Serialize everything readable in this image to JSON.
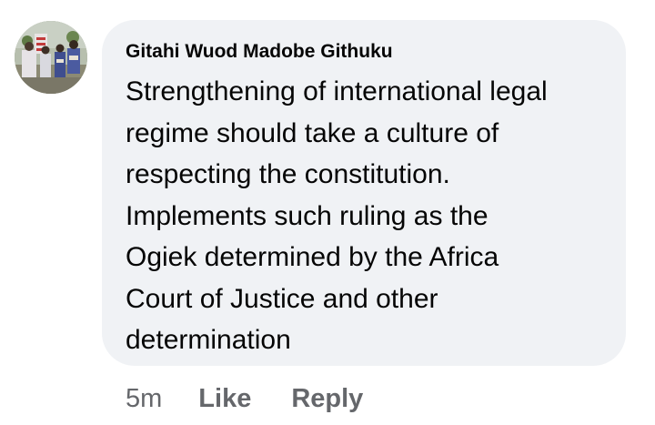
{
  "comment": {
    "author": "Gitahi Wuod Madobe Githuku",
    "avatar_icon": "profile-photo",
    "text": "Strengthening of international legal\nregime should take a culture of\nrespecting the constitution.\nImplements such ruling as the\nOgiek determined by the Africa\nCourt  of Justice and other\ndetermination",
    "timestamp": "5m",
    "like_label": "Like",
    "reply_label": "Reply"
  },
  "colors": {
    "bubble_background": "#f0f2f5",
    "text": "#050505",
    "secondary_text": "#65676b"
  }
}
